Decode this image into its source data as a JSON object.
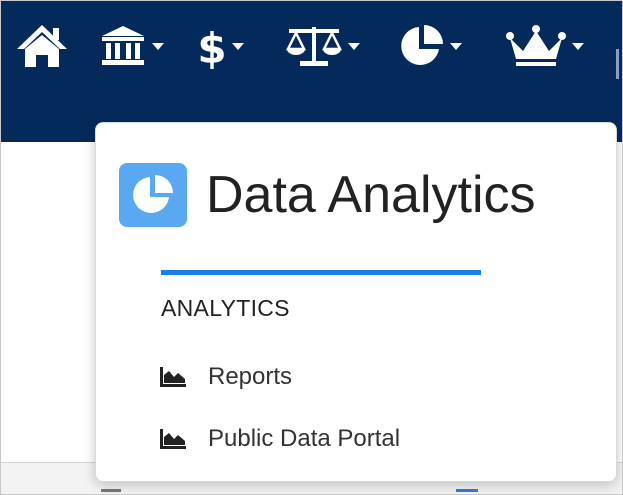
{
  "colors": {
    "navbar_bg": "#042a5c",
    "nav_icon": "#ffffff",
    "dropdown_icon_bg": "#5aa7f2",
    "accent_rule": "#1a7ee8"
  },
  "navbar": {
    "items": [
      {
        "icon": "home-icon",
        "has_dropdown": false
      },
      {
        "icon": "government-building-icon",
        "has_dropdown": true
      },
      {
        "icon": "dollar-icon",
        "has_dropdown": true
      },
      {
        "icon": "scales-icon",
        "has_dropdown": true
      },
      {
        "icon": "pie-chart-icon",
        "has_dropdown": true,
        "active": true
      },
      {
        "icon": "crown-icon",
        "has_dropdown": true
      }
    ]
  },
  "dropdown": {
    "icon": "pie-chart-icon",
    "title": "Data Analytics",
    "section_heading": "ANALYTICS",
    "links": [
      {
        "icon": "area-chart-icon",
        "label": "Reports"
      },
      {
        "icon": "area-chart-icon",
        "label": "Public Data Portal"
      }
    ]
  }
}
